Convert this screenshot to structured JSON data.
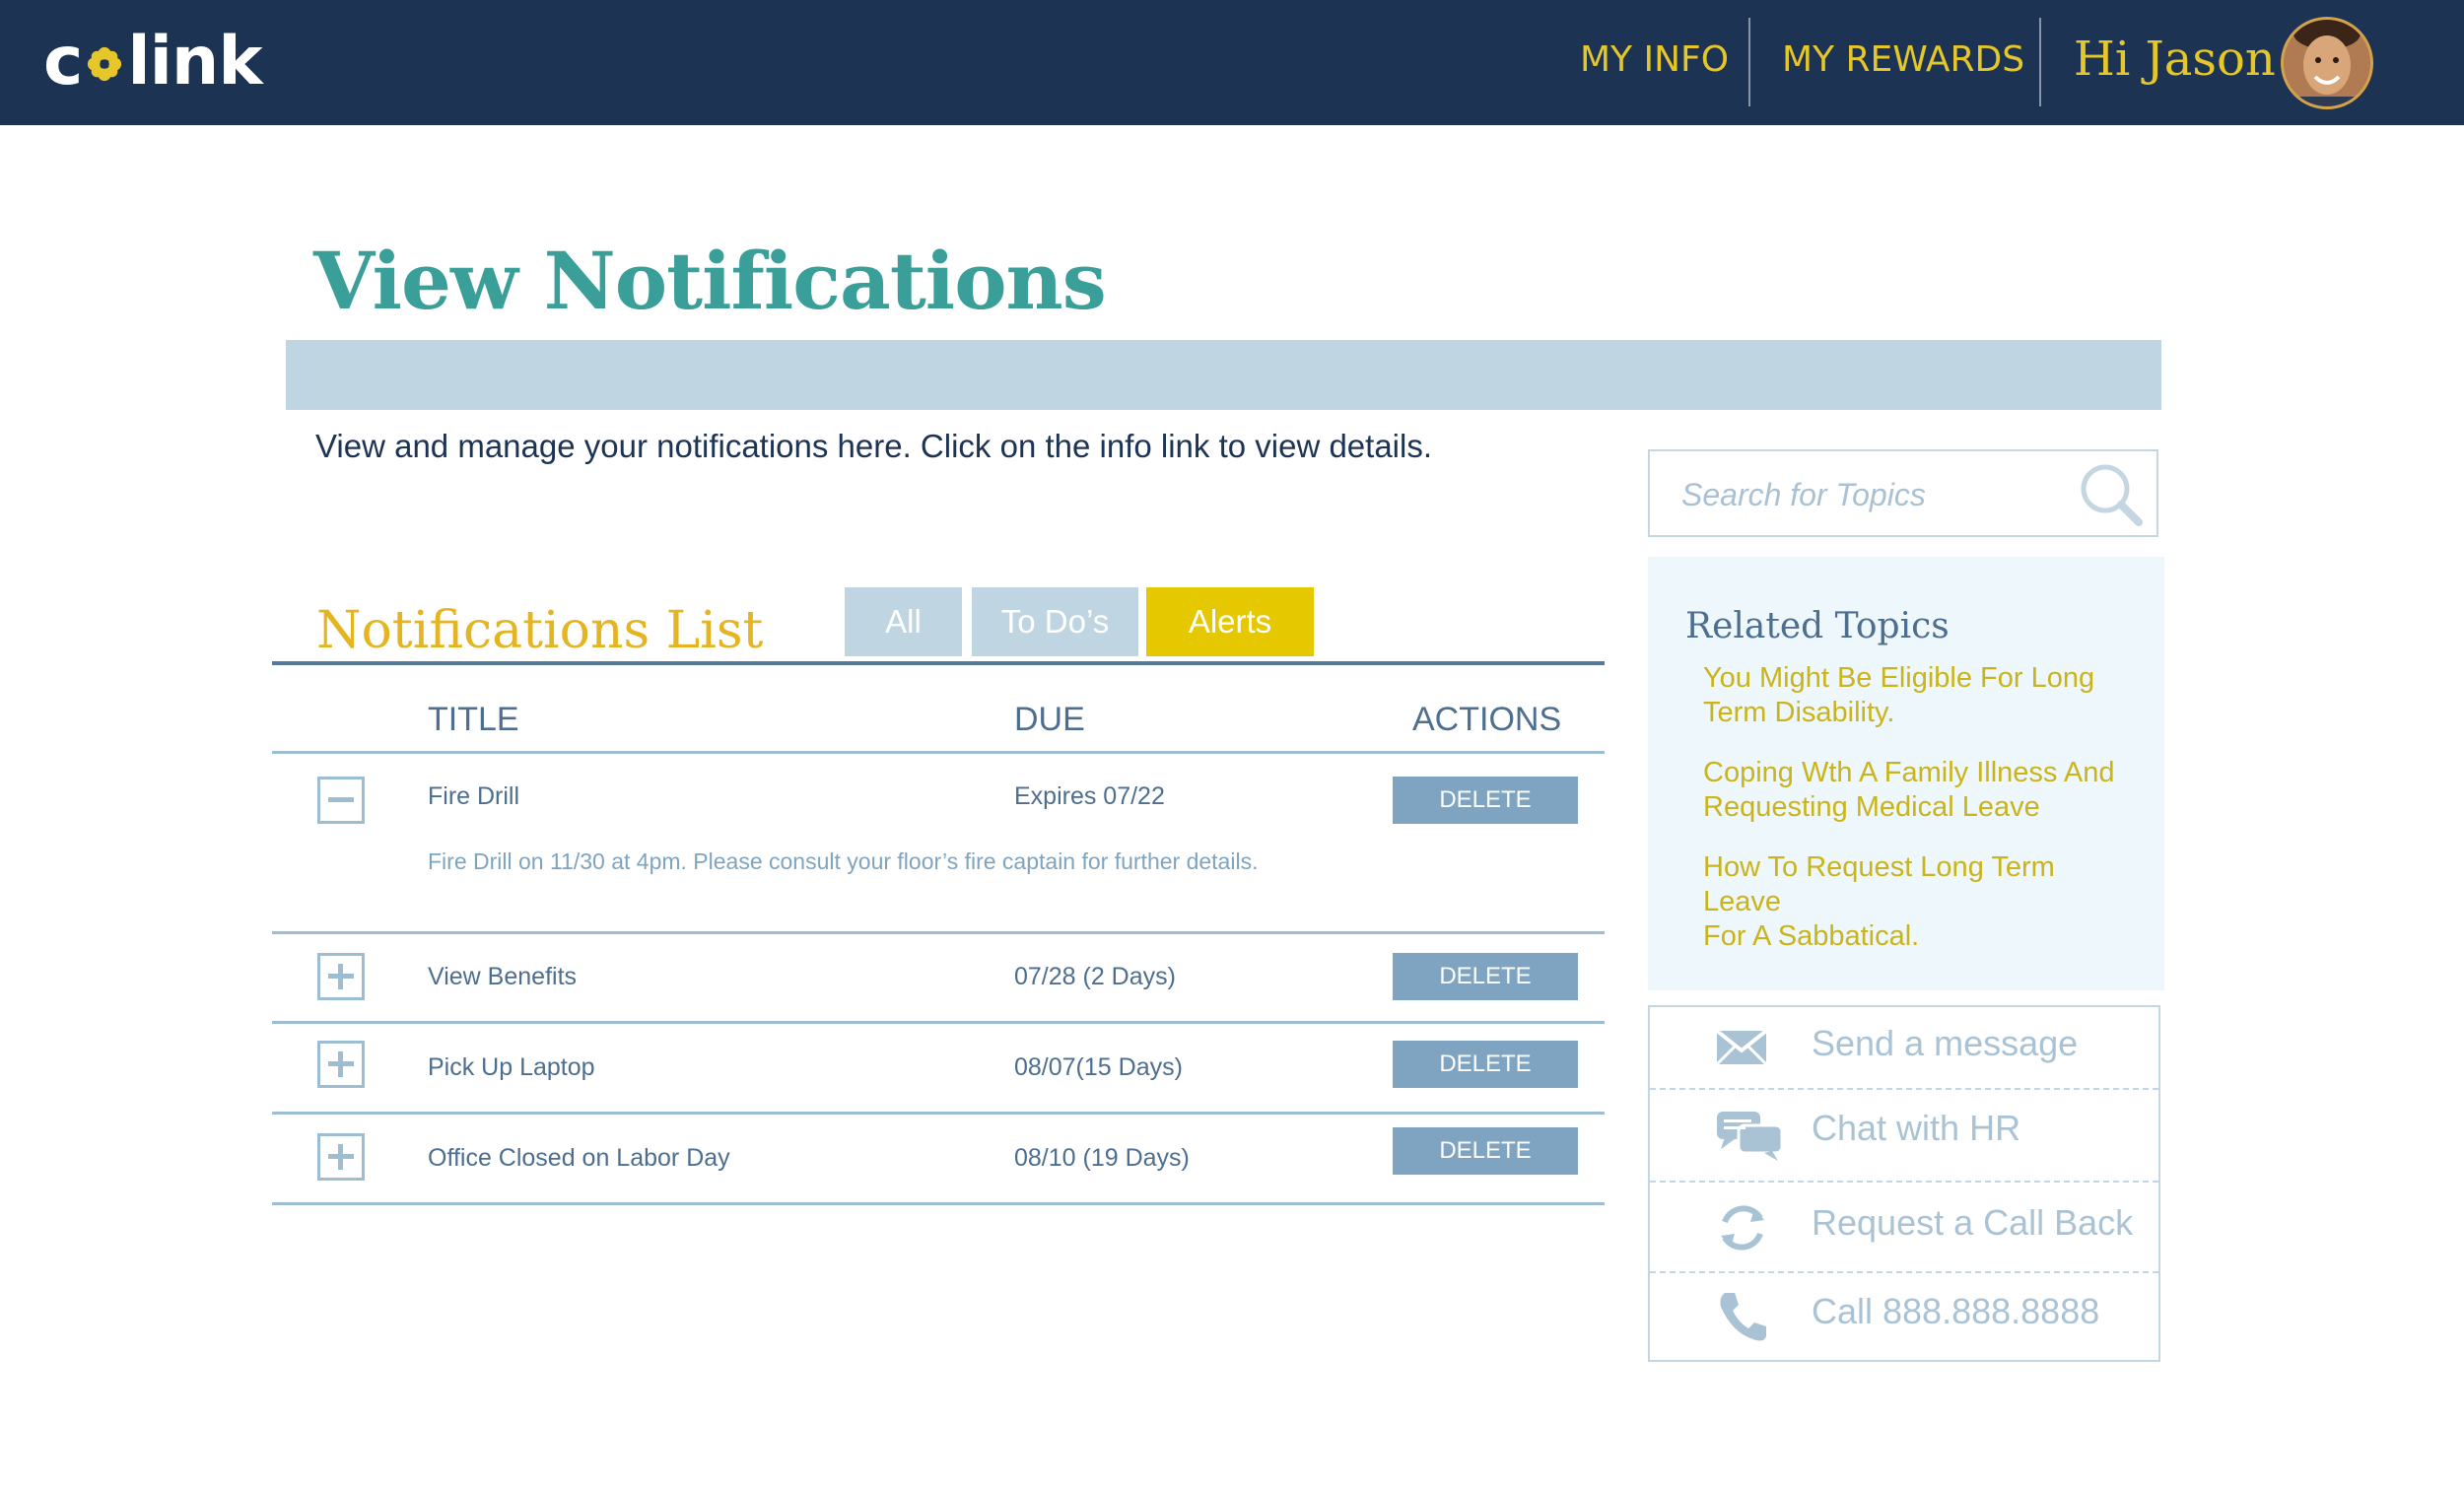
{
  "header": {
    "logo_left": "c",
    "logo_right": "link",
    "nav": [
      "MY INFO",
      "MY REWARDS"
    ],
    "greeting": "Hi Jason"
  },
  "page": {
    "title": "View Notifications",
    "intro": "View and manage your notifications here. Click on the info link to view details."
  },
  "notifications": {
    "title": "Notifications List",
    "tabs": [
      {
        "label": "All",
        "active": false
      },
      {
        "label": "To Do’s",
        "active": false
      },
      {
        "label": "Alerts",
        "active": true
      }
    ],
    "columns": [
      "TITLE",
      "DUE",
      "ACTIONS"
    ],
    "rows": [
      {
        "title": "Fire Drill",
        "due": "Expires 07/22",
        "action": "DELETE",
        "expanded": true,
        "detail": "Fire Drill on 11/30 at 4pm. Please consult your floor’s fire captain for further details."
      },
      {
        "title": "View Benefits",
        "due": "07/28 (2 Days)",
        "action": "DELETE",
        "expanded": false
      },
      {
        "title": "Pick Up Laptop",
        "due": "08/07(15 Days)",
        "action": "DELETE",
        "expanded": false
      },
      {
        "title": "Office Closed on Labor Day",
        "due": "08/10 (19 Days)",
        "action": "DELETE",
        "expanded": false
      }
    ]
  },
  "search": {
    "placeholder": "Search for Topics"
  },
  "related": {
    "title": "Related Topics",
    "links": [
      [
        "You Might Be Eligible For Long",
        "Term Disability."
      ],
      [
        "Coping  Wth A Family Illness And",
        "Requesting Medical Leave"
      ],
      [
        "How To Request Long Term",
        "Leave",
        "For A Sabbatical."
      ]
    ]
  },
  "contact": {
    "items": [
      {
        "label": "Send a message",
        "icon": "envelope-icon"
      },
      {
        "label": "Chat with HR",
        "icon": "chat-bubbles-icon"
      },
      {
        "label": "Request a Call Back",
        "icon": "refresh-icon"
      },
      {
        "label": "Call 888.888.8888",
        "icon": "phone-icon"
      }
    ]
  },
  "colors": {
    "header_bg": "#1c3353",
    "accent_yellow": "#e6c72a",
    "teal_title": "#3a9e99",
    "light_blue": "#bfd6e2",
    "button_blue": "#7fa4c2"
  }
}
